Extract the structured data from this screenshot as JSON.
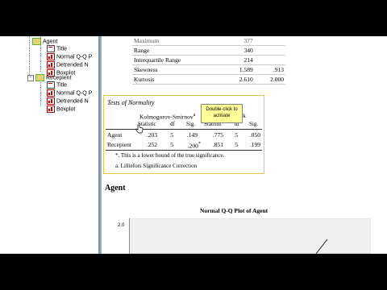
{
  "navigator": {
    "items": [
      {
        "label": "Agent",
        "kind": "folder"
      },
      {
        "label": "Title",
        "kind": "title"
      },
      {
        "label": "Normal Q-Q P",
        "kind": "chart"
      },
      {
        "label": "Detrended N",
        "kind": "chart"
      },
      {
        "label": "Boxplot",
        "kind": "chart"
      },
      {
        "label": "Recepient",
        "kind": "folder"
      },
      {
        "label": "Title",
        "kind": "title"
      },
      {
        "label": "Normal Q-Q P",
        "kind": "chart"
      },
      {
        "label": "Detrended N",
        "kind": "chart"
      },
      {
        "label": "Boxplot",
        "kind": "chart"
      }
    ]
  },
  "descriptives": {
    "rows": [
      {
        "label": "Maximum",
        "stat": "377",
        "se": ""
      },
      {
        "label": "Range",
        "stat": "340",
        "se": ""
      },
      {
        "label": "Interquartile Range",
        "stat": "214",
        "se": ""
      },
      {
        "label": "Skewness",
        "stat": "1.589",
        "se": ".913"
      },
      {
        "label": "Kurtosis",
        "stat": "2.610",
        "se": "2.000"
      }
    ]
  },
  "normality": {
    "title": "Tests of Normality",
    "ks_header": "Kolmogorov-Smirnov",
    "ks_sup": "a",
    "sw_header": "Shapiro-Wilk",
    "col_statistic": "Statistic",
    "col_df": "df",
    "col_sig": "Sig.",
    "rows": [
      {
        "label": "Agent",
        "ks_stat": ".203",
        "ks_df": "5",
        "ks_sig": ".149",
        "sw_stat": ".775",
        "sw_df": "5",
        "sw_sig": ".050"
      },
      {
        "label": "Recepient",
        "ks_stat": ".252",
        "ks_df": "5",
        "ks_sig": ".200",
        "ks_sig_sup": "*",
        "sw_stat": ".851",
        "sw_df": "5",
        "sw_sig": ".199"
      }
    ],
    "footnote_star": "*. This is a lower bound of the true significance.",
    "footnote_a": "a. Lilliefors Significance Correction",
    "tooltip": "Double-click to activate"
  },
  "section_heading": "Agent",
  "plot": {
    "title": "Normal Q-Q Plot of Agent",
    "y_tick": "2.0"
  },
  "colors": {
    "navigator_border": "#7a8fb8",
    "tooltip_bg": "#ffff99",
    "pivot_border": "#e4c84a"
  }
}
